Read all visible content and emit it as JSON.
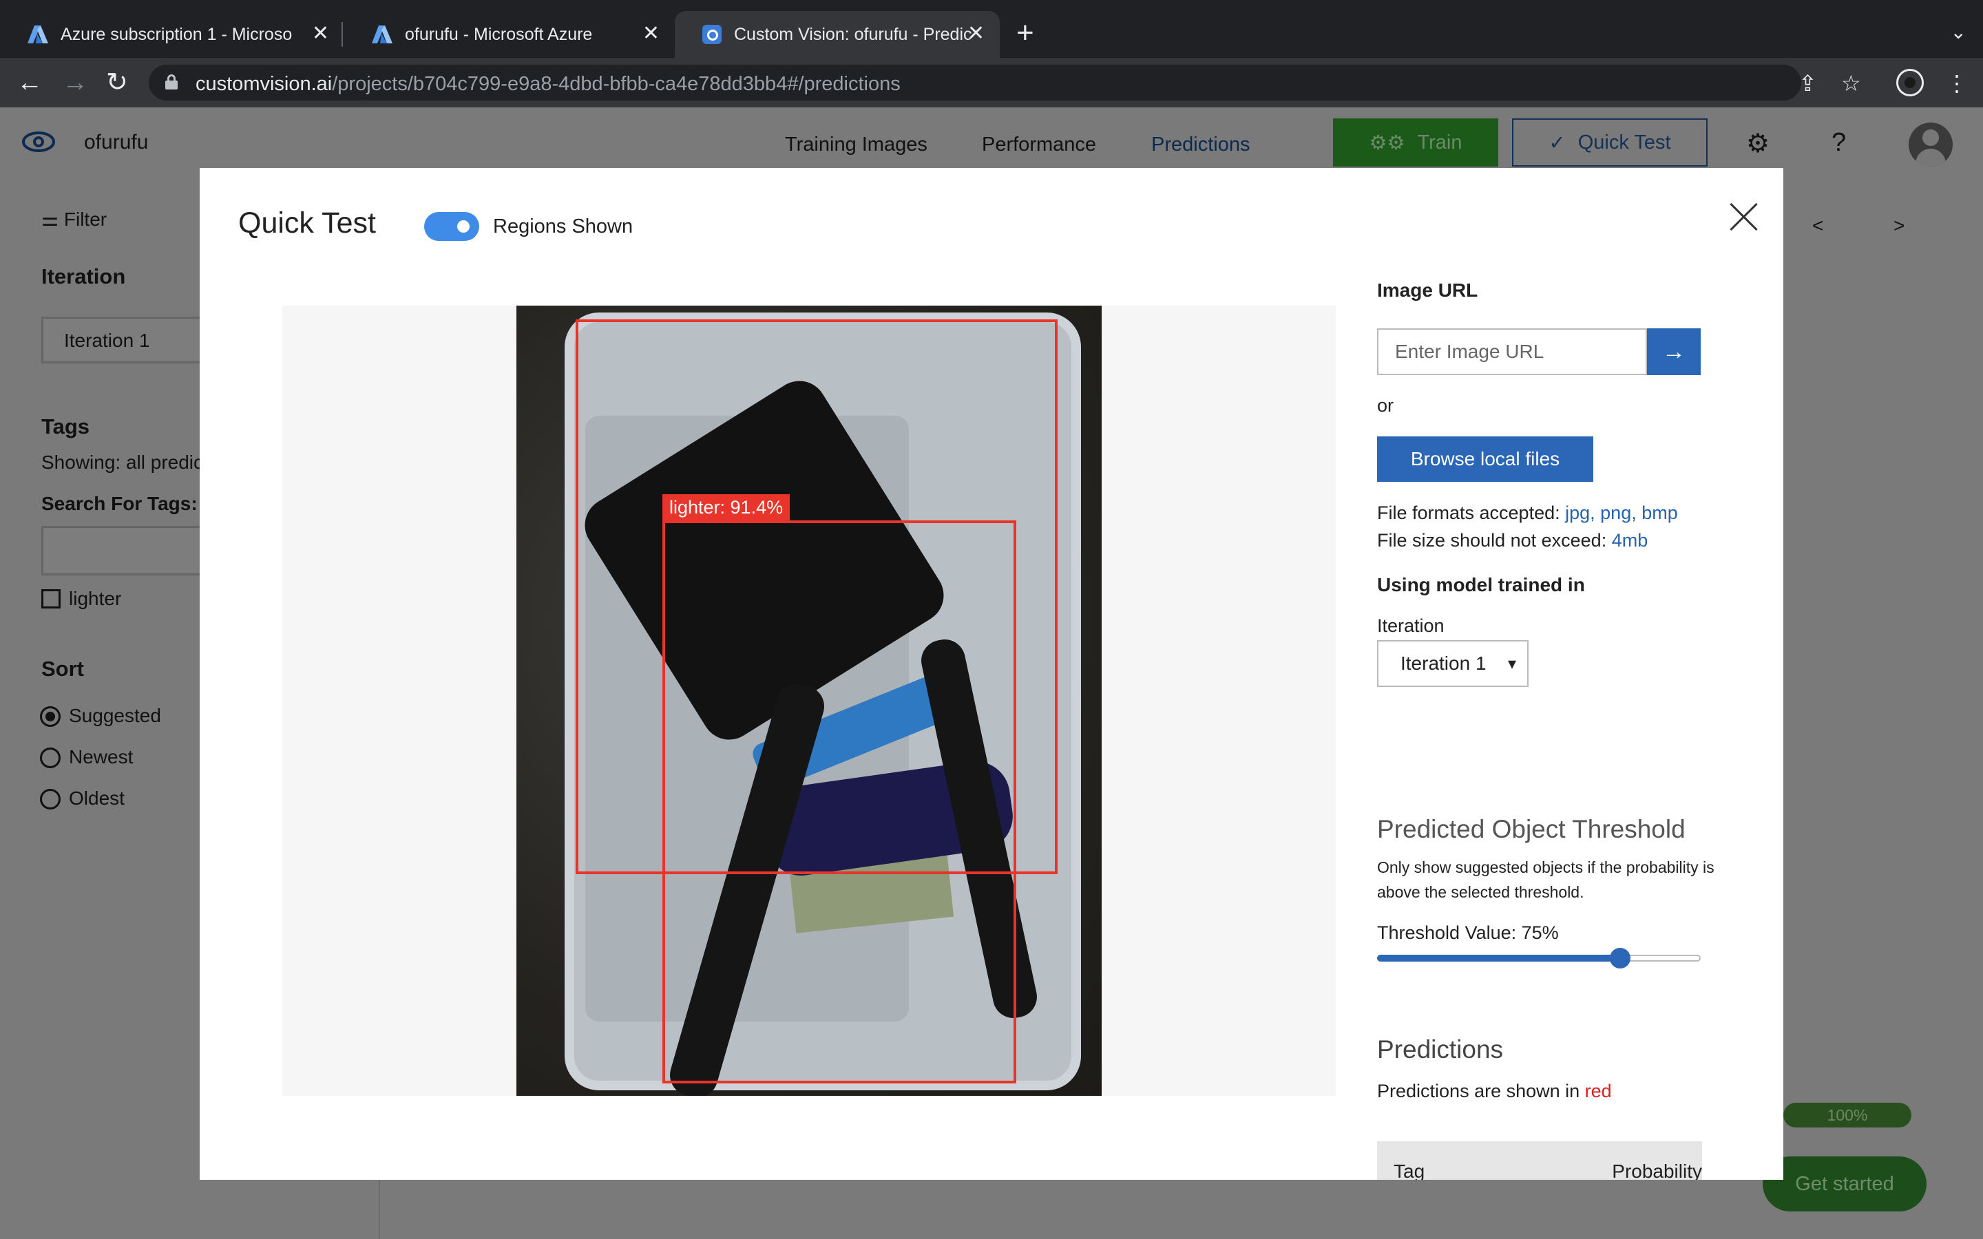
{
  "browser": {
    "tabs": [
      {
        "title": "Azure subscription 1 - Microso",
        "close": "✕"
      },
      {
        "title": "ofurufu - Microsoft Azure",
        "close": "✕"
      },
      {
        "title": "Custom Vision: ofurufu - Predic",
        "close": "✕"
      }
    ],
    "new_tab": "+",
    "url_host": "customvision.ai",
    "url_path": "/projects/b704c799-e9a8-4dbd-bfbb-ca4e78dd3bb4#/predictions"
  },
  "app": {
    "project_name": "ofurufu",
    "nav": [
      "Training Images",
      "Performance",
      "Predictions"
    ],
    "active_nav": "Predictions",
    "train_label": "Train",
    "quick_test_label": "Quick Test",
    "settings_icon": "⚙",
    "help_icon": "?"
  },
  "sidebar": {
    "filter_label": "Filter",
    "iteration_heading": "Iteration",
    "iteration_value": "Iteration 1",
    "tags_heading": "Tags",
    "showing_text": "Showing: all predic",
    "search_label": "Search For Tags:",
    "tag_item": "lighter",
    "sort_heading": "Sort",
    "sort_options": [
      "Suggested",
      "Newest",
      "Oldest"
    ],
    "sort_selected": "Suggested"
  },
  "background": {
    "pager_prev": "<",
    "pager_next": ">",
    "progress_label": "100%",
    "progress_value": 1.0,
    "get_started_label": "Get started"
  },
  "modal": {
    "title": "Quick Test",
    "regions_toggle_label": "Regions Shown",
    "regions_shown": true,
    "detection_label": "lighter: 91.4%",
    "image_url_heading": "Image URL",
    "image_url_placeholder": "Enter Image URL",
    "go_icon": "→",
    "or_text": "or",
    "browse_label": "Browse local files",
    "formats_prefix": "File formats accepted: ",
    "formats": "jpg, png, bmp",
    "size_prefix": "File size should not exceed: ",
    "size": "4mb",
    "model_heading": "Using model trained in",
    "iteration_label": "Iteration",
    "iteration_value": "Iteration 1",
    "threshold_heading": "Predicted Object Threshold",
    "threshold_desc": "Only show suggested objects if the probability is above the selected threshold.",
    "threshold_label": "Threshold Value: 75%",
    "threshold_value": 0.75,
    "predictions_heading": "Predictions",
    "predictions_prefix": "Predictions are shown in ",
    "predictions_color_word": "red",
    "table_headers": [
      "Tag",
      "Probability"
    ]
  }
}
